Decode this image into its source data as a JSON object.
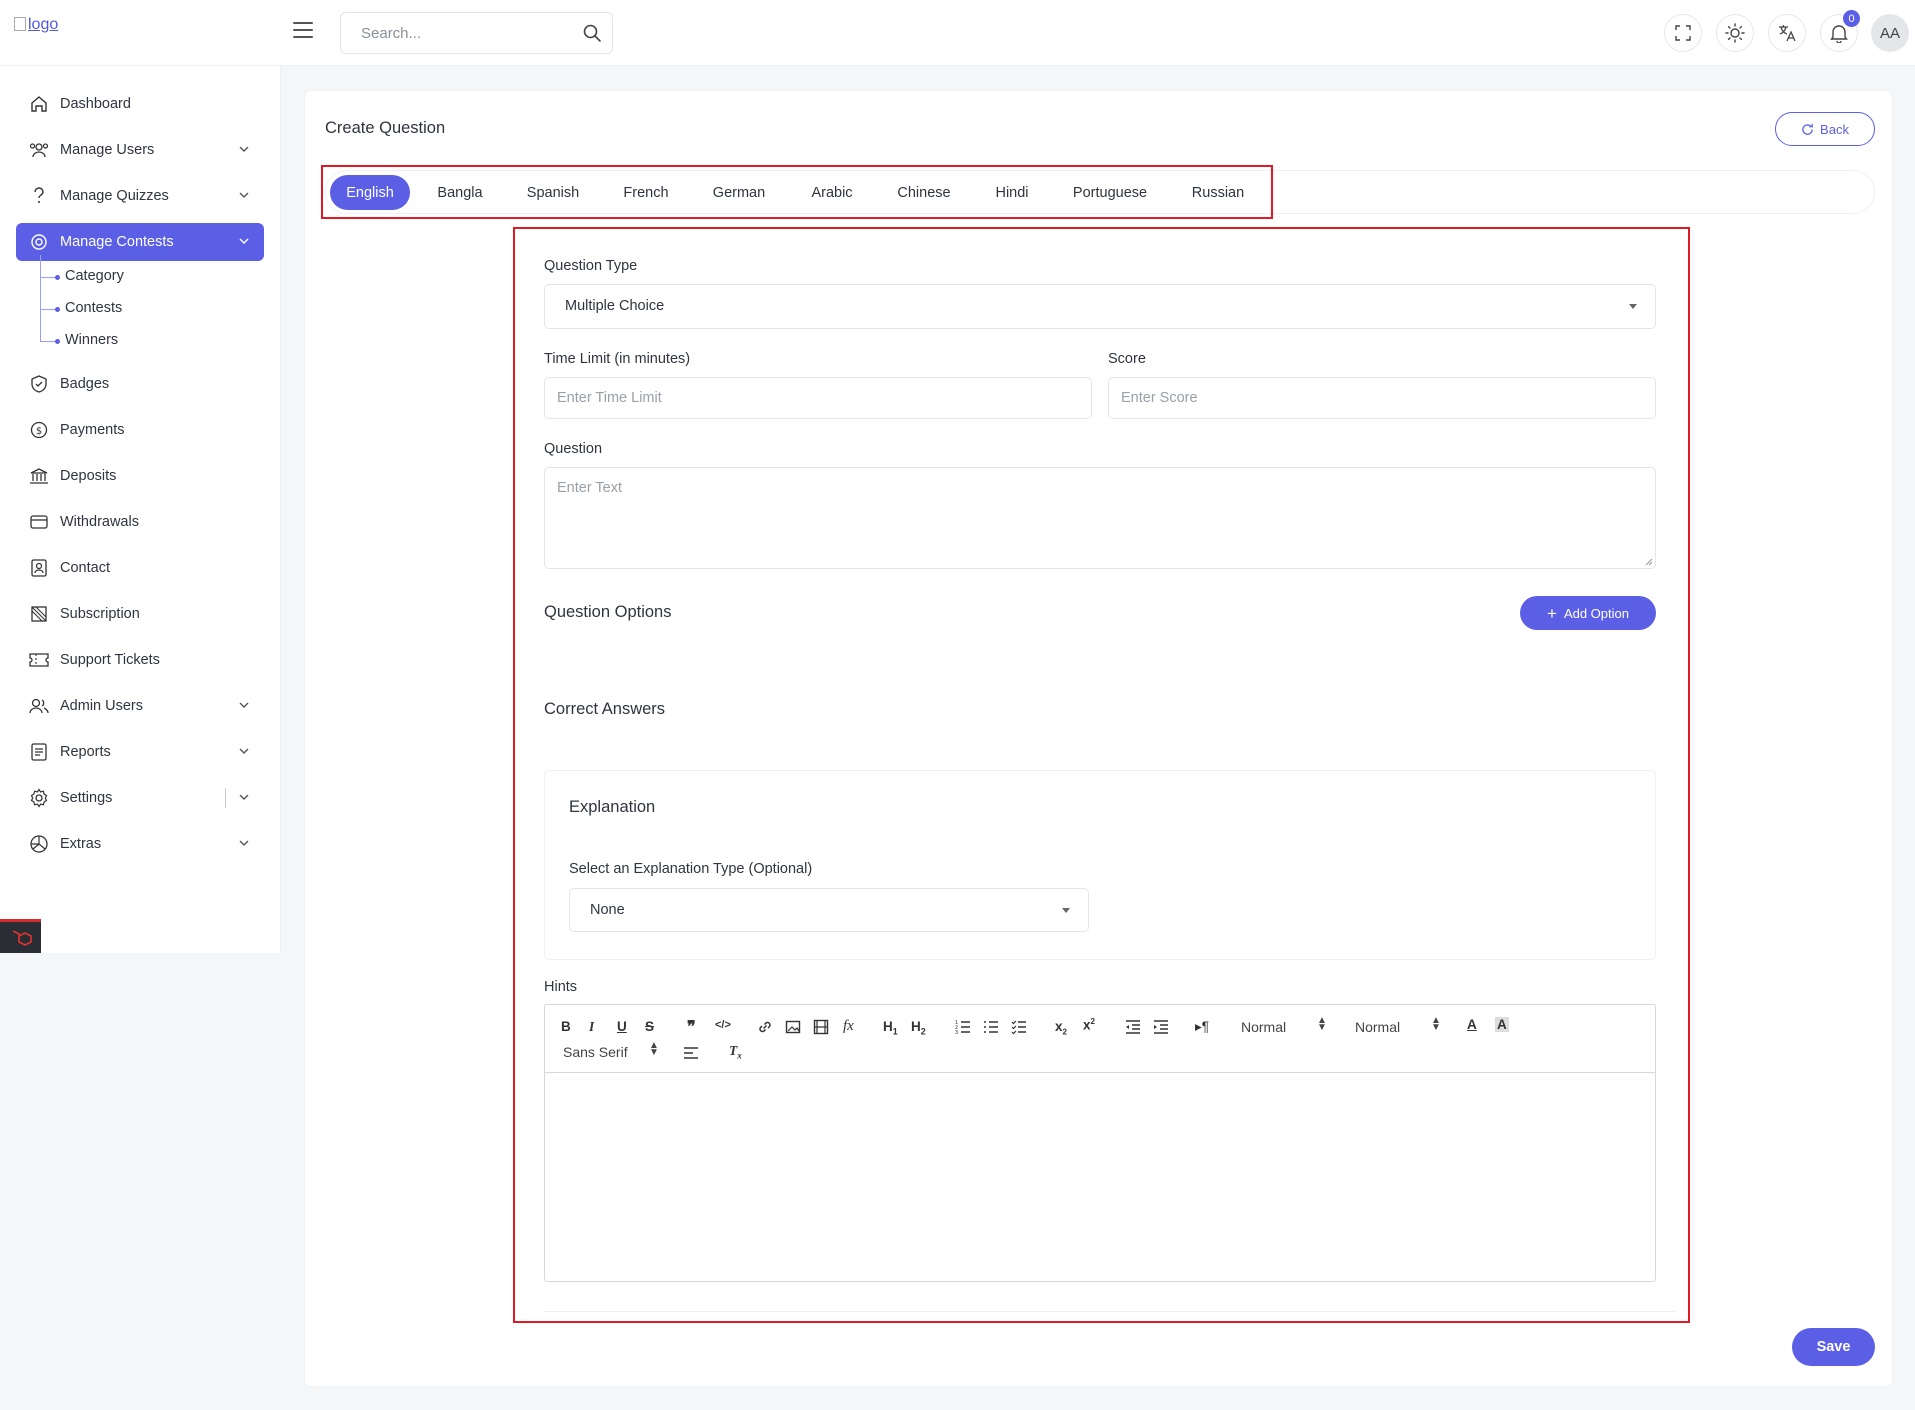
{
  "header": {
    "logo_alt": "logo",
    "search_placeholder": "Search...",
    "notification_count": "0",
    "avatar_initials": "AA"
  },
  "sidebar": {
    "items": [
      {
        "label": "Dashboard",
        "icon": "home-icon"
      },
      {
        "label": "Manage Users",
        "icon": "users-icon",
        "has_children": true
      },
      {
        "label": "Manage Quizzes",
        "icon": "question-icon",
        "has_children": true
      },
      {
        "label": "Manage Contests",
        "icon": "contest-icon",
        "has_children": true,
        "active": true
      },
      {
        "label": "Badges",
        "icon": "badge-icon"
      },
      {
        "label": "Payments",
        "icon": "dollar-icon"
      },
      {
        "label": "Deposits",
        "icon": "bank-icon"
      },
      {
        "label": "Withdrawals",
        "icon": "wallet-icon"
      },
      {
        "label": "Contact",
        "icon": "contact-icon"
      },
      {
        "label": "Subscription",
        "icon": "subscription-icon"
      },
      {
        "label": "Support Tickets",
        "icon": "ticket-icon"
      },
      {
        "label": "Admin Users",
        "icon": "admin-users-icon",
        "has_children": true
      },
      {
        "label": "Reports",
        "icon": "reports-icon",
        "has_children": true
      },
      {
        "label": "Settings",
        "icon": "gear-icon",
        "has_children": true
      },
      {
        "label": "Extras",
        "icon": "extras-icon",
        "has_children": true
      }
    ],
    "contest_children": [
      "Category",
      "Contests",
      "Winners"
    ]
  },
  "page": {
    "title": "Create Question",
    "back_label": "Back"
  },
  "tabs": [
    "English",
    "Bangla",
    "Spanish",
    "French",
    "German",
    "Arabic",
    "Chinese",
    "Hindi",
    "Portuguese",
    "Russian"
  ],
  "active_tab": "English",
  "form": {
    "question_type_label": "Question Type",
    "question_type_value": "Multiple Choice",
    "time_limit_label": "Time Limit (in minutes)",
    "time_limit_placeholder": "Enter Time Limit",
    "score_label": "Score",
    "score_placeholder": "Enter Score",
    "question_label": "Question",
    "question_placeholder": "Enter Text",
    "options_heading": "Question Options",
    "add_option_label": "Add Option",
    "correct_answers_heading": "Correct Answers",
    "explanation_heading": "Explanation",
    "explanation_type_label": "Select an Explanation Type (Optional)",
    "explanation_type_value": "None",
    "hints_label": "Hints",
    "editor": {
      "header_select": "Normal",
      "size_select": "Normal",
      "font_select": "Sans Serif"
    },
    "save_label": "Save"
  }
}
